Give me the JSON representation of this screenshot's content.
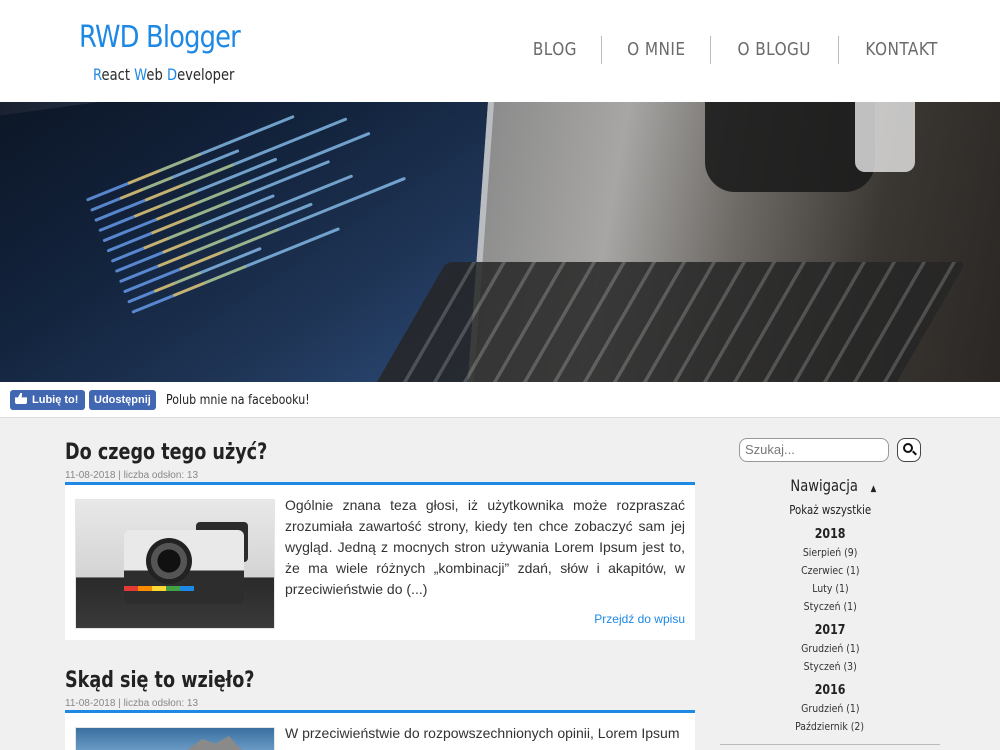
{
  "header": {
    "title": "RWD Blogger",
    "subtitle_parts": [
      {
        "cap": "R",
        "rest": "eact "
      },
      {
        "cap": "W",
        "rest": "eb "
      },
      {
        "cap": "D",
        "rest": "eveloper"
      }
    ],
    "nav": [
      "BLOG",
      "O MNIE",
      "O BLOGU",
      "KONTAKT"
    ]
  },
  "facebook": {
    "like_label": "Lubię to!",
    "share_label": "Udostępnij",
    "text": "Polub mnie na facebooku!"
  },
  "posts": [
    {
      "title": "Do czego tego użyć?",
      "meta": "11-08-2018 | liczba odsłon: 13",
      "excerpt": "Ogólnie znana teza głosi, iż użytkownika może rozpraszać zrozumiała zawartość strony, kiedy ten chce zobaczyć sam jej wygląd. Jedną z mocnych stron używania Lorem Ipsum jest to, że ma wiele różnych „kombinacji” zdań, słów i akapitów, w przeciwieństwie do (...)",
      "link": "Przejdź do wpisu"
    },
    {
      "title": "Skąd się to wzięło?",
      "meta": "11-08-2018 | liczba odsłon: 13",
      "excerpt": "W przeciwieństwie do rozpowszechnionych opinii, Lorem Ipsum"
    }
  ],
  "search": {
    "placeholder": "Szukaj..."
  },
  "sidebar": {
    "heading": "Nawigacja",
    "show_all": "Pokaż wszystkie",
    "archive": [
      {
        "year": "2018",
        "months": [
          "Sierpień (9)",
          "Czerwiec (1)",
          "Luty (1)",
          "Styczeń (1)"
        ]
      },
      {
        "year": "2017",
        "months": [
          "Grudzień (1)",
          "Styczeń (3)"
        ]
      },
      {
        "year": "2016",
        "months": [
          "Grudzień (1)",
          "Październik (2)"
        ]
      }
    ]
  }
}
